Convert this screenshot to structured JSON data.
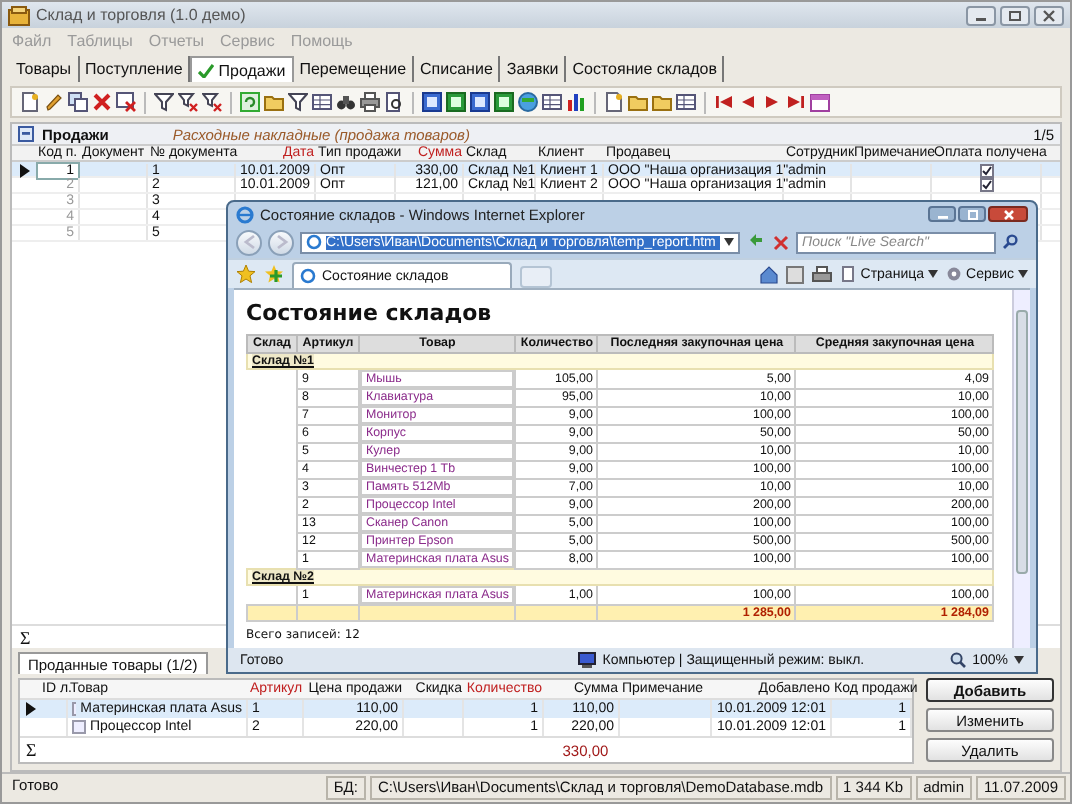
{
  "window": {
    "title": "Склад и торговля (1.0 демо)"
  },
  "menu": [
    "Файл",
    "Таблицы",
    "Отчеты",
    "Сервис",
    "Помощь"
  ],
  "tabs": [
    {
      "label": "Товары",
      "selected": false
    },
    {
      "label": "Поступление",
      "selected": false
    },
    {
      "label": "Продажи",
      "selected": true
    },
    {
      "label": "Перемещение",
      "selected": false
    },
    {
      "label": "Списание",
      "selected": false
    },
    {
      "label": "Заявки",
      "selected": false
    },
    {
      "label": "Состояние складов",
      "selected": false
    }
  ],
  "sales": {
    "title": "Продажи",
    "subtitle": "Расходные накладные (продажа товаров)",
    "counter": "1/5",
    "columns": [
      {
        "label": "Код п.",
        "required": false
      },
      {
        "label": "Документ",
        "required": false
      },
      {
        "label": "№ документа",
        "required": false
      },
      {
        "label": "Дата",
        "required": true
      },
      {
        "label": "Тип продажи",
        "required": false
      },
      {
        "label": "Сумма",
        "required": true
      },
      {
        "label": "Склад",
        "required": false
      },
      {
        "label": "Клиент",
        "required": false
      },
      {
        "label": "Продавец",
        "required": false
      },
      {
        "label": "Сотрудник",
        "required": false
      },
      {
        "label": "Примечание",
        "required": false
      },
      {
        "label": "Оплата получена",
        "required": false
      }
    ],
    "rows": [
      {
        "code": "1",
        "number": "1",
        "date": "10.01.2009",
        "type": "Опт",
        "sum": "330,00",
        "warehouse": "Склад №1",
        "client": "Клиент 1",
        "seller": "ООО \"Наша организация 1\"",
        "employee": "admin",
        "paid": true,
        "selected": true
      },
      {
        "code": "2",
        "number": "2",
        "date": "10.01.2009",
        "type": "Опт",
        "sum": "121,00",
        "warehouse": "Склад №1",
        "client": "Клиент 2",
        "seller": "ООО \"Наша организация 1\"",
        "employee": "admin",
        "paid": true,
        "selected": false
      },
      {
        "code": "3",
        "number": "3",
        "selected": false
      },
      {
        "code": "4",
        "number": "4",
        "selected": false
      },
      {
        "code": "5",
        "number": "5",
        "selected": false
      }
    ],
    "sigma": "Σ"
  },
  "items": {
    "tab": "Проданные товары (1/2)",
    "columns": [
      {
        "label": "ID л.",
        "required": false
      },
      {
        "label": "Товар",
        "required": false
      },
      {
        "label": "Артикул",
        "required": true
      },
      {
        "label": "Цена продажи",
        "required": false
      },
      {
        "label": "Скидка",
        "required": false
      },
      {
        "label": "Количество",
        "required": true
      },
      {
        "label": "Сумма",
        "required": false
      },
      {
        "label": "Примечание",
        "required": false
      },
      {
        "label": "Добавлено",
        "required": false
      },
      {
        "label": "Код продажи",
        "required": false
      }
    ],
    "rows": [
      {
        "product": "Материнская плата Asus",
        "article": "1",
        "price": "110,00",
        "qty": "1",
        "sum": "110,00",
        "added": "10.01.2009 12:01",
        "sale_code": "1",
        "selected": true
      },
      {
        "product": "Процессор Intel",
        "article": "2",
        "price": "220,00",
        "qty": "1",
        "sum": "220,00",
        "added": "10.01.2009 12:01",
        "sale_code": "1",
        "selected": false
      }
    ],
    "sigma": "Σ",
    "total": "330,00"
  },
  "buttons": [
    "Добавить",
    "Изменить",
    "Удалить"
  ],
  "status_bar": {
    "state": "Готово",
    "db_label": "БД:",
    "db_path": "C:\\Users\\Иван\\Documents\\Склад и торговля\\DemoDatabase.mdb",
    "size": "1 344 Kb",
    "user": "admin",
    "date": "11.07.2009"
  },
  "browser": {
    "title": "Состояние складов - Windows Internet Explorer",
    "address": "C:\\Users\\Иван\\Documents\\Склад и торговля\\temp_report.htm",
    "search_placeholder": "Поиск \"Live Search\"",
    "tab": "Состояние складов",
    "commands": [
      "Страница",
      "Сервис"
    ],
    "report": {
      "heading": "Состояние складов",
      "columns": [
        "Склад",
        "Артикул",
        "Товар",
        "Количество",
        "Последняя закупочная цена",
        "Средняя закупочная цена"
      ],
      "groups": [
        {
          "name": "Склад №1",
          "rows": [
            [
              "9",
              "Мышь",
              "105,00",
              "5,00",
              "4,09"
            ],
            [
              "8",
              "Клавиатура",
              "95,00",
              "10,00",
              "10,00"
            ],
            [
              "7",
              "Монитор",
              "9,00",
              "100,00",
              "100,00"
            ],
            [
              "6",
              "Корпус",
              "9,00",
              "50,00",
              "50,00"
            ],
            [
              "5",
              "Кулер",
              "9,00",
              "10,00",
              "10,00"
            ],
            [
              "4",
              "Винчестер 1 Tb",
              "9,00",
              "100,00",
              "100,00"
            ],
            [
              "3",
              "Память 512Mb",
              "7,00",
              "10,00",
              "10,00"
            ],
            [
              "2",
              "Процессор Intel",
              "9,00",
              "200,00",
              "200,00"
            ],
            [
              "13",
              "Сканер Canon",
              "5,00",
              "100,00",
              "100,00"
            ],
            [
              "12",
              "Принтер Epson",
              "5,00",
              "500,00",
              "500,00"
            ],
            [
              "1",
              "Материнская плата Asus",
              "8,00",
              "100,00",
              "100,00"
            ]
          ]
        },
        {
          "name": "Склад №2",
          "rows": [
            [
              "1",
              "Материнская плата Asus",
              "1,00",
              "100,00",
              "100,00"
            ]
          ]
        }
      ],
      "totals": [
        "1 285,00",
        "1 284,09"
      ],
      "count": "Всего записей: 12"
    },
    "status": "Готово",
    "zone": "Компьютер | Защищенный режим: выкл.",
    "zoom": "100%"
  }
}
